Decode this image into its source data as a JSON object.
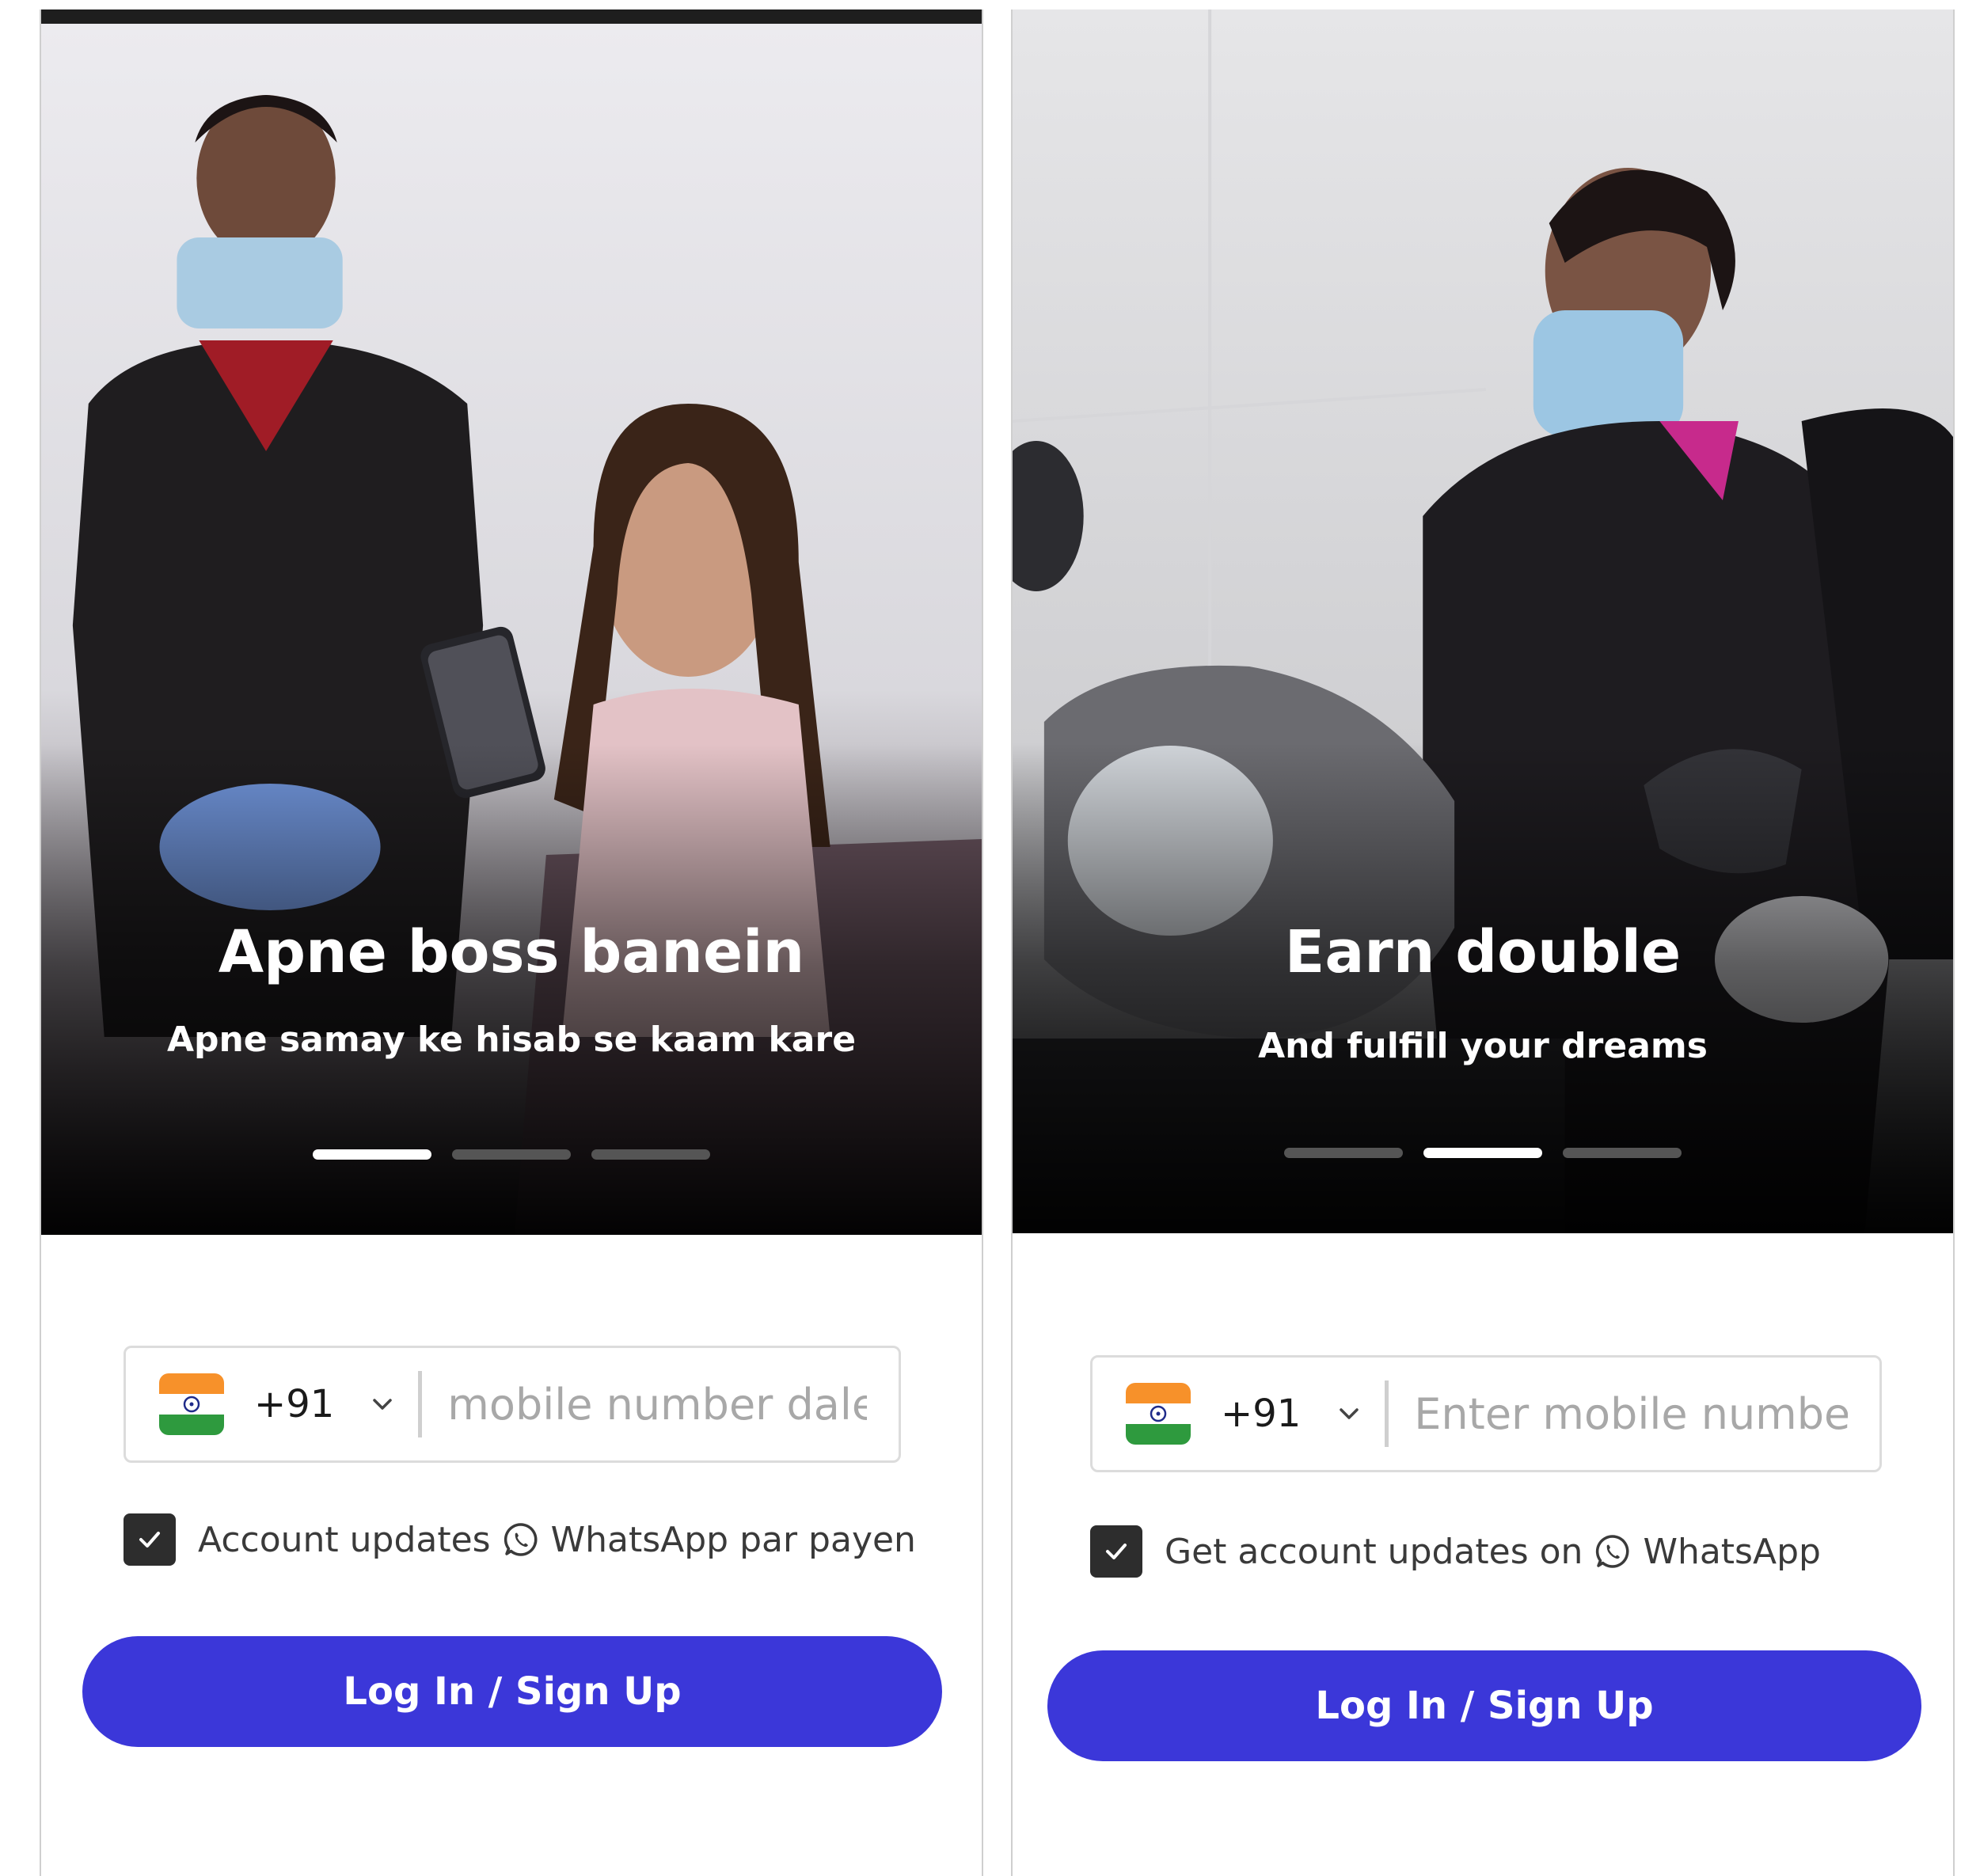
{
  "colors": {
    "primary_button": "#3b37d9",
    "checkbox": "#2d2d2d",
    "carousel_dot_active": "#ffffff",
    "carousel_dot_inactive": "#555555",
    "input_border": "#dcdcdc"
  },
  "screens": [
    {
      "hero": {
        "title": "Apne boss banein",
        "subtitle": "Apne samay ke hisab se kaam kare",
        "carousel": {
          "total": 3,
          "active_index": 0
        }
      },
      "phone": {
        "country_flag": "india-flag-icon",
        "country_code": "+91",
        "placeholder": "mobile number dale"
      },
      "consent": {
        "checked": true,
        "text_before": "Account updates",
        "icon": "whatsapp-icon",
        "text_after": "WhatsApp par payen"
      },
      "button_label": "Log In / Sign Up"
    },
    {
      "hero": {
        "title": "Earn double",
        "subtitle": "And fulfill your dreams",
        "carousel": {
          "total": 3,
          "active_index": 1
        }
      },
      "phone": {
        "country_flag": "india-flag-icon",
        "country_code": "+91",
        "placeholder": "Enter mobile number"
      },
      "consent": {
        "checked": true,
        "text_before": "Get account updates on",
        "icon": "whatsapp-icon",
        "text_after": "WhatsApp"
      },
      "button_label": "Log In / Sign Up"
    }
  ]
}
